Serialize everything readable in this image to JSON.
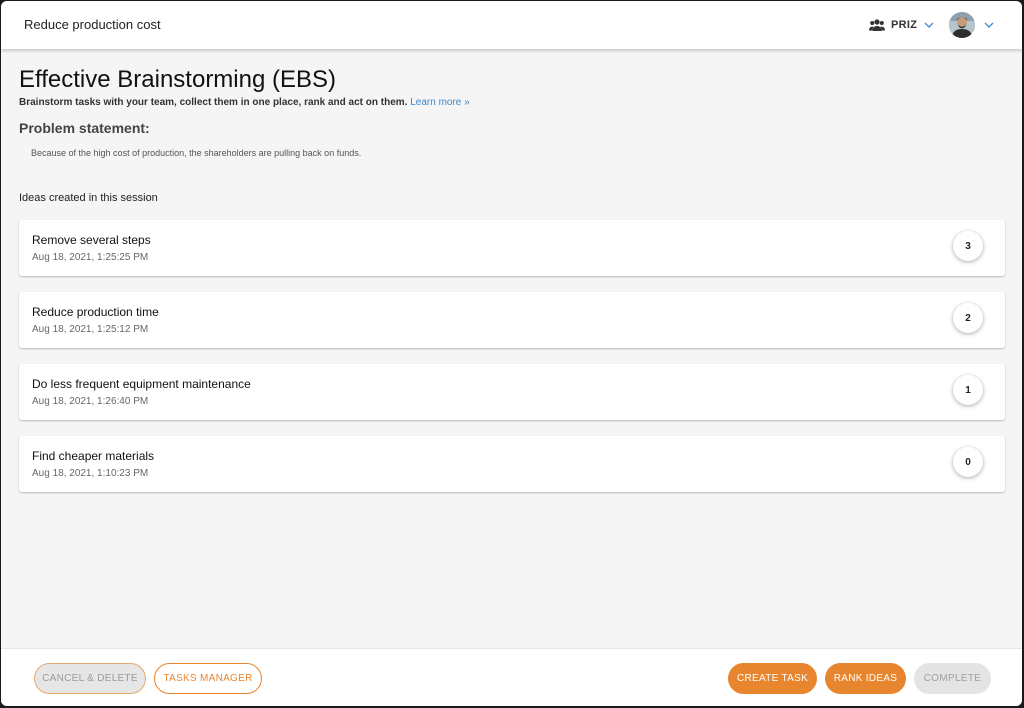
{
  "header": {
    "app_title": "Reduce production cost",
    "team_label": "PRIZ"
  },
  "main": {
    "title": "Effective Brainstorming (EBS)",
    "subtitle": "Brainstorm tasks with your team, collect them in one place, rank and act on them.",
    "learn_more": "Learn more »",
    "problem_heading": "Problem statement:",
    "problem_text": "Because of the high cost of production, the shareholders are pulling back on funds.",
    "ideas_heading": "Ideas created in this session",
    "ideas": [
      {
        "title": "Remove several steps",
        "date": "Aug 18, 2021, 1:25:25 PM",
        "rank": "3"
      },
      {
        "title": "Reduce production time",
        "date": "Aug 18, 2021, 1:25:12 PM",
        "rank": "2"
      },
      {
        "title": "Do less frequent equipment maintenance",
        "date": "Aug 18, 2021, 1:26:40 PM",
        "rank": "1"
      },
      {
        "title": "Find cheaper materials",
        "date": "Aug 18, 2021, 1:10:23 PM",
        "rank": "0"
      }
    ]
  },
  "footer": {
    "cancel_label": "CANCEL & DELETE",
    "tasks_label": "TASKS MANAGER",
    "create_label": "CREATE TASK",
    "rank_label": "RANK IDEAS",
    "complete_label": "COMPLETE"
  },
  "colors": {
    "accent": "#e8862f",
    "link": "#3a86c8",
    "background": "#f5f5f5"
  },
  "icons": {
    "team": "people-icon",
    "dropdown": "chevron-down-icon",
    "user": "avatar"
  }
}
